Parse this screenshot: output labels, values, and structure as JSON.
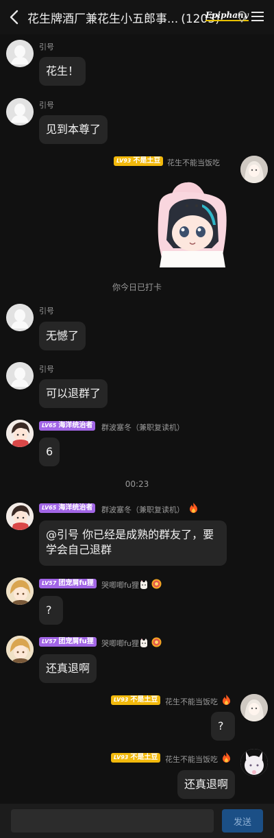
{
  "header": {
    "title": "花生牌酒厂兼花生小五郎事...",
    "count": "(1203)",
    "brand": "Epiphany"
  },
  "messages": [
    {
      "sender": "引号",
      "text": "花生！"
    },
    {
      "sender": "引号",
      "text": "见到本尊了"
    },
    {
      "sender": "花生不能当饭吃",
      "badge": {
        "level": "LV93",
        "title": "不是土豆"
      },
      "image": "sticker-bunny-hood-girl"
    },
    {
      "sender": "引号",
      "text": "无憾了"
    },
    {
      "sender": "引号",
      "text": "可以退群了"
    },
    {
      "sender": "群波塞冬（兼职复读机）",
      "badge": {
        "level": "LV65",
        "title": "海洋统治者"
      },
      "text": "6"
    },
    {
      "sender": "群波塞冬（兼职复读机）",
      "badge": {
        "level": "LV65",
        "title": "海洋统治者"
      },
      "text": "@引号 你已经是成熟的群友了，要学会自己退群"
    },
    {
      "sender": "哭唧唧fu狸",
      "badge": {
        "level": "LV57",
        "title": "团宠屑fu狸"
      },
      "text": "?"
    },
    {
      "sender": "哭唧唧fu狸",
      "badge": {
        "level": "LV57",
        "title": "团宠屑fu狸"
      },
      "text": "还真退啊"
    },
    {
      "sender": "花生不能当饭吃",
      "badge": {
        "level": "LV93",
        "title": "不是土豆"
      },
      "text": "?"
    },
    {
      "sender": "花生不能当饭吃",
      "badge": {
        "level": "LV93",
        "title": "不是土豆"
      },
      "text": "还真退啊"
    }
  ],
  "system": {
    "checkin": "你今日已打卡",
    "time": "00:23"
  },
  "input": {
    "placeholder": "",
    "send_label": "发送"
  },
  "colors": {
    "background": "#111111",
    "bubble": "#262626",
    "badge_purple": "#a266e6",
    "badge_yellow": "#f2b90c",
    "send_button": "#1b4f86"
  }
}
